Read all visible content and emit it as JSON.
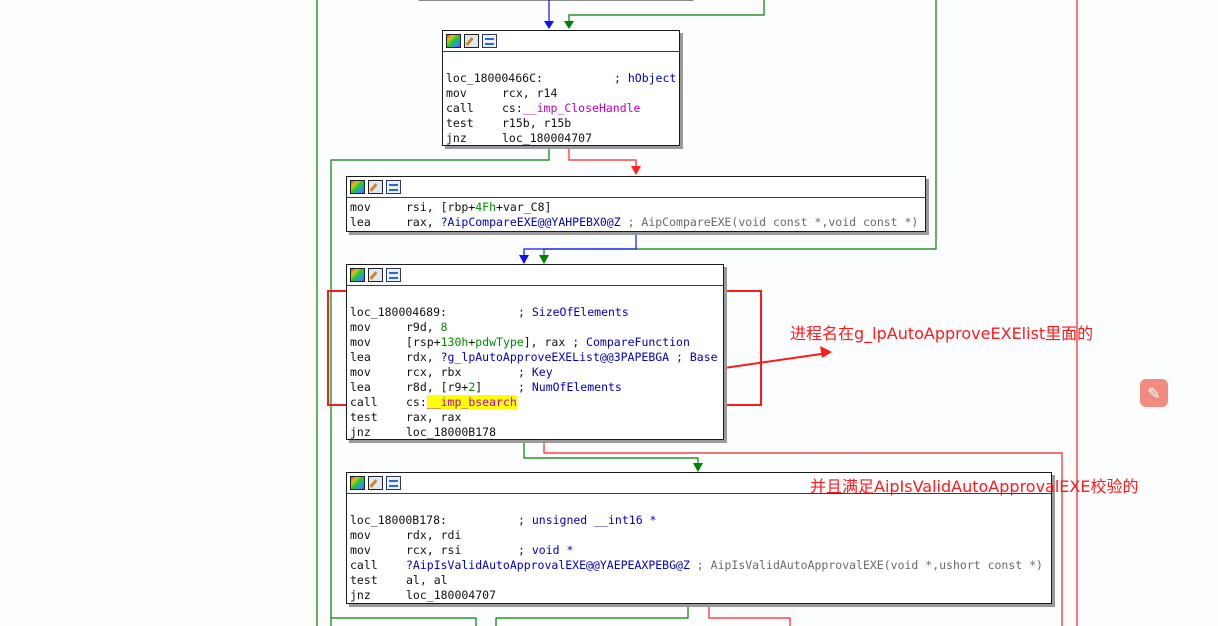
{
  "colors": {
    "edge_green": "#008000",
    "edge_red": "#ff2020",
    "edge_blue": "#1010ff",
    "annotation": "#ff1a1a",
    "highlight": "#ffff00",
    "fab": "#f28a80"
  },
  "node_header_icons": [
    "graph-overview-icon",
    "edit-node-icon",
    "xrefs-graph-icon"
  ],
  "blocks": {
    "b1": {
      "label": "loc_18000466C:",
      "label_comment": "; hObject",
      "l1": {
        "mn": "mov",
        "op": "rcx, r14"
      },
      "l2": {
        "mn": "call",
        "pre": "cs:",
        "imp": "__imp_CloseHandle"
      },
      "l3": {
        "mn": "test",
        "op": "r15b, r15b"
      },
      "l4": {
        "mn": "jnz",
        "op": "loc_180004707"
      }
    },
    "b2": {
      "l1": {
        "mn": "mov",
        "a": "rsi, [rbp+",
        "num": "4Fh",
        "b": "+var_C8]"
      },
      "l2": {
        "mn": "lea",
        "a": "rax, ",
        "sym": "?AipCompareEXE@@YAHPEBX0@Z",
        "cmt": " ; AipCompareEXE(void const *,void const *)"
      }
    },
    "b3": {
      "label": "loc_180004689:",
      "label_comment": "; SizeOfElements",
      "l1": {
        "mn": "mov",
        "a": "r9d, ",
        "num": "8"
      },
      "l2": {
        "mn": "mov",
        "a": "[rsp+",
        "num": "130h",
        "b": "+",
        "var": "pdwType",
        "c": "], rax",
        "cmt": " ; CompareFunction"
      },
      "l3": {
        "mn": "lea",
        "a": "rdx, ",
        "sym": "?g_lpAutoApproveEXEList@@3PAPEBGA",
        "cmt": " ; Base"
      },
      "l4": {
        "mn": "mov",
        "a": "rcx, rbx",
        "cmt": "; Key"
      },
      "l5": {
        "mn": "lea",
        "a": "r8d, [r9+",
        "num": "2",
        "b": "]",
        "cmt": "; NumOfElements"
      },
      "l6": {
        "mn": "call",
        "pre": "cs:",
        "imp": "__imp_bsearch"
      },
      "l7": {
        "mn": "test",
        "op": "rax, rax"
      },
      "l8": {
        "mn": "jnz",
        "op": "loc_18000B178"
      }
    },
    "b4": {
      "label": "loc_18000B178:",
      "label_comment": "; unsigned __int16 *",
      "l1": {
        "mn": "mov",
        "op": "rdx, rdi"
      },
      "l2": {
        "mn": "mov",
        "a": "rcx, rsi",
        "cmt": "; void *"
      },
      "l3": {
        "mn": "call",
        "sym": "?AipIsValidAutoApprovalEXE@@YAEPEAXPEBG@Z",
        "cmt": " ; AipIsValidAutoApprovalEXE(void *,ushort const *)"
      },
      "l4": {
        "mn": "test",
        "op": "al, al"
      },
      "l5": {
        "mn": "jnz",
        "op": "loc_180004707"
      }
    }
  },
  "annotations": {
    "note1": "进程名在g_lpAutoApproveEXElist里面的",
    "note2": "并且满足AipIsValidAutoApprovalEXE校验的"
  },
  "fab_icon": "edit-sparkle-icon",
  "fab_glyph": "✎"
}
